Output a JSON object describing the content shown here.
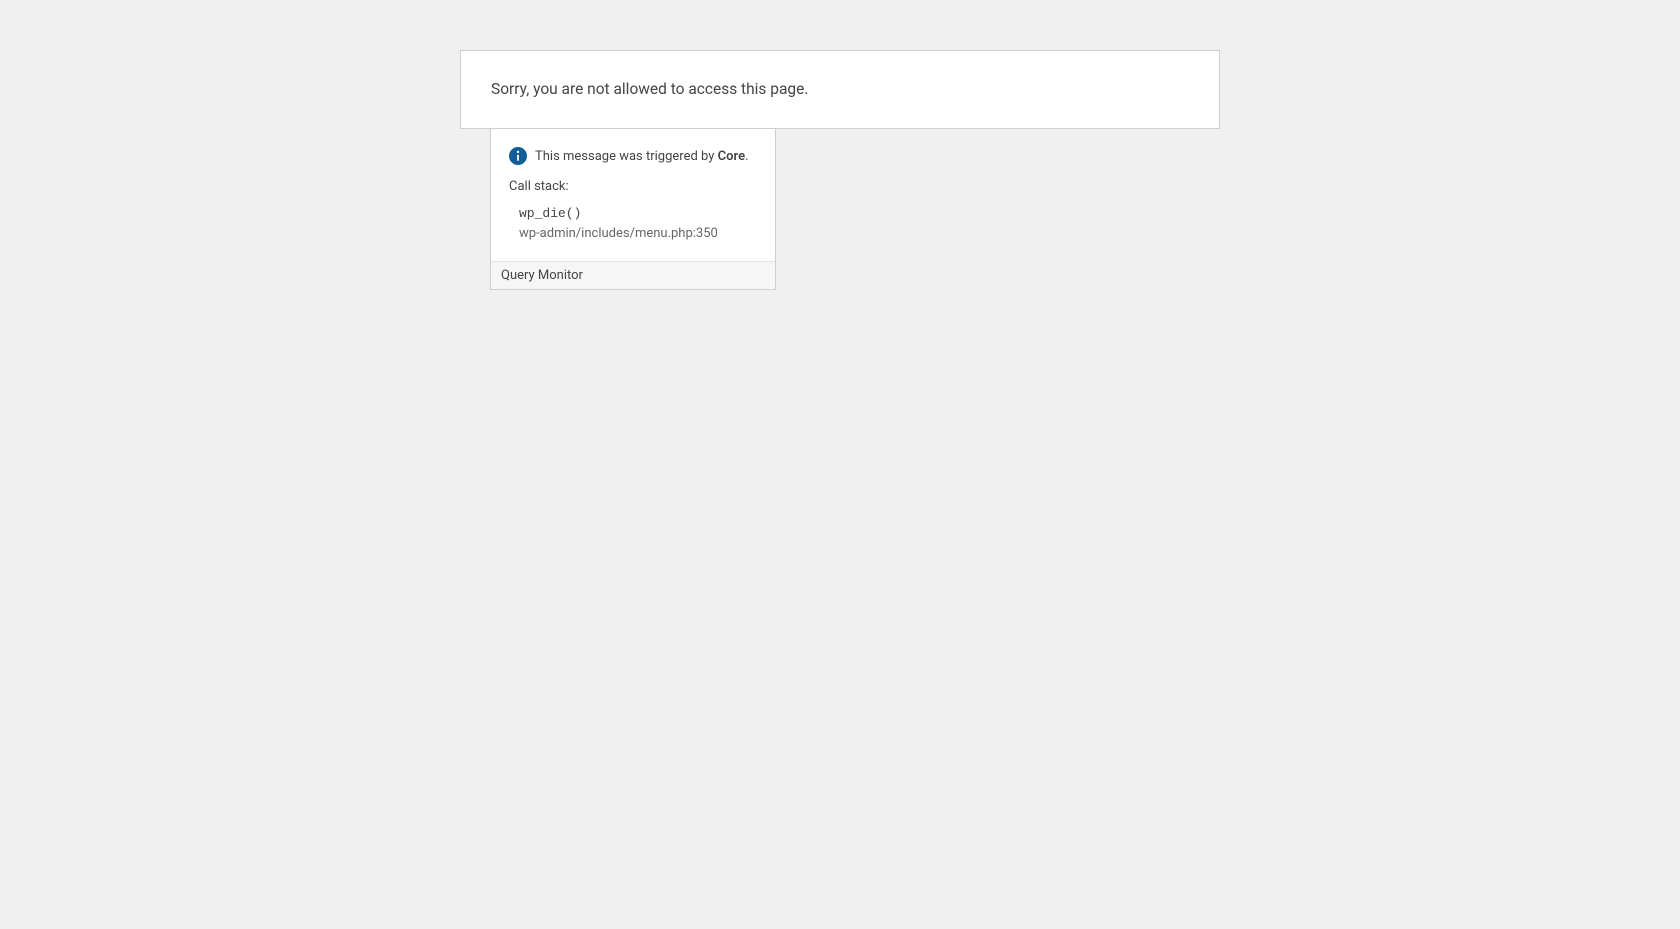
{
  "error": {
    "message": "Sorry, you are not allowed to access this page."
  },
  "qm": {
    "trigger_prefix": "This message was triggered by ",
    "trigger_source": "Core",
    "trigger_suffix": ".",
    "callstack_label": "Call stack:",
    "stack": {
      "fn": "wp_die()",
      "file": "wp-admin/includes/menu.php:350"
    },
    "footer_label": "Query Monitor"
  }
}
